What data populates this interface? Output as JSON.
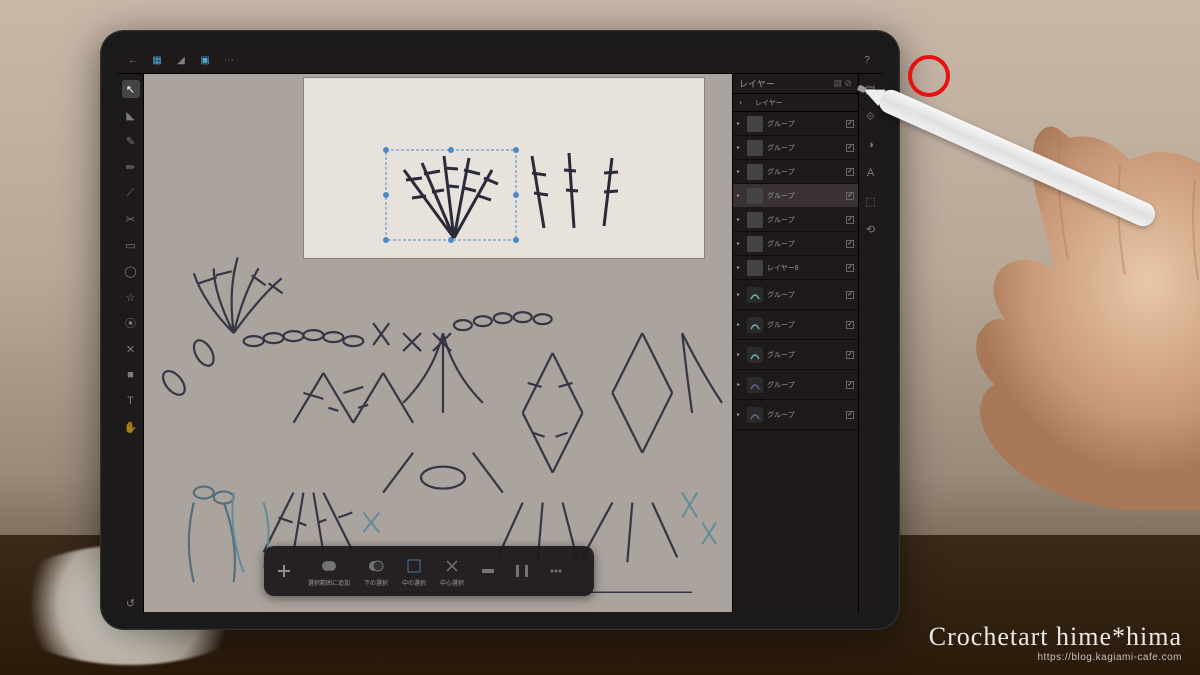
{
  "panel": {
    "title": "レイヤー",
    "sub": "レイヤー"
  },
  "layers": [
    {
      "name": "グループ",
      "checked": true,
      "type": "group"
    },
    {
      "name": "グループ",
      "checked": true,
      "type": "group"
    },
    {
      "name": "グループ",
      "checked": true,
      "type": "group"
    },
    {
      "name": "グループ",
      "checked": true,
      "type": "group",
      "active": true
    },
    {
      "name": "グループ",
      "checked": true,
      "type": "group"
    },
    {
      "name": "グループ",
      "checked": true,
      "type": "group"
    },
    {
      "name": "レイヤー8",
      "checked": true,
      "type": "layer"
    },
    {
      "name": "グループ",
      "checked": true,
      "type": "shape",
      "color": "#6eb4b4"
    },
    {
      "name": "グループ",
      "checked": true,
      "type": "shape",
      "color": "#6eb4b4"
    },
    {
      "name": "グループ",
      "checked": true,
      "type": "shape",
      "color": "#6eb4b4"
    },
    {
      "name": "グループ",
      "checked": true,
      "type": "shape",
      "color": "#668"
    },
    {
      "name": "グループ",
      "checked": true,
      "type": "shape",
      "color": "#668"
    }
  ],
  "selection_toolbar": {
    "labels": [
      "選択範囲に追加",
      "下の選択",
      "中の選択",
      "中心選択"
    ]
  },
  "watermark": {
    "title": "Crochetart hime*hima",
    "url": "https://blog.kagiami-cafe.com"
  }
}
